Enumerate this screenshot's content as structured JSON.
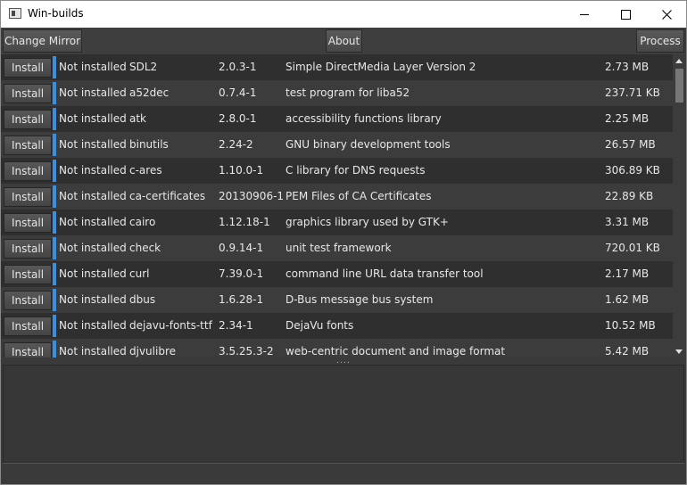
{
  "window": {
    "title": "Win-builds",
    "controls": {
      "minimize": "minimize-icon",
      "maximize": "maximize-icon",
      "close": "close-icon"
    }
  },
  "toolbar": {
    "change_mirror_label": "Change Mirror",
    "about_label": "About",
    "process_label": "Process"
  },
  "packages": [
    {
      "action": "Install",
      "status": "Not installed",
      "name": "SDL2",
      "version": "2.0.3-1",
      "description": "Simple DirectMedia Layer Version 2",
      "size": "2.73 MB"
    },
    {
      "action": "Install",
      "status": "Not installed",
      "name": "a52dec",
      "version": "0.7.4-1",
      "description": "test program for liba52",
      "size": "237.71 KB"
    },
    {
      "action": "Install",
      "status": "Not installed",
      "name": "atk",
      "version": "2.8.0-1",
      "description": "accessibility functions library",
      "size": "2.25 MB"
    },
    {
      "action": "Install",
      "status": "Not installed",
      "name": "binutils",
      "version": "2.24-2",
      "description": "GNU binary development tools",
      "size": "26.57 MB"
    },
    {
      "action": "Install",
      "status": "Not installed",
      "name": "c-ares",
      "version": "1.10.0-1",
      "description": "C library for DNS requests",
      "size": "306.89 KB"
    },
    {
      "action": "Install",
      "status": "Not installed",
      "name": "ca-certificates",
      "version": "20130906-1",
      "description": "PEM Files of CA Certificates",
      "size": "22.89 KB"
    },
    {
      "action": "Install",
      "status": "Not installed",
      "name": "cairo",
      "version": "1.12.18-1",
      "description": "graphics library used by GTK+",
      "size": "3.31 MB"
    },
    {
      "action": "Install",
      "status": "Not installed",
      "name": "check",
      "version": "0.9.14-1",
      "description": "unit test framework",
      "size": "720.01 KB"
    },
    {
      "action": "Install",
      "status": "Not installed",
      "name": "curl",
      "version": "7.39.0-1",
      "description": "command line URL data transfer tool",
      "size": "2.17 MB"
    },
    {
      "action": "Install",
      "status": "Not installed",
      "name": "dbus",
      "version": "1.6.28-1",
      "description": "D-Bus message bus system",
      "size": "1.62 MB"
    },
    {
      "action": "Install",
      "status": "Not installed",
      "name": "dejavu-fonts-ttf",
      "version": "2.34-1",
      "description": "DejaVu fonts",
      "size": "10.52 MB"
    },
    {
      "action": "Install",
      "status": "Not installed",
      "name": "djvulibre",
      "version": "3.5.25.3-2",
      "description": "web-centric document and image format",
      "size": "5.42 MB"
    }
  ],
  "splitter_grip": "....",
  "colors": {
    "status_marker": "#3b8fe0",
    "row_dark": "#2f2f2f",
    "row_light": "#3c3c3c",
    "toolbar_bg": "#3e3e3e"
  }
}
